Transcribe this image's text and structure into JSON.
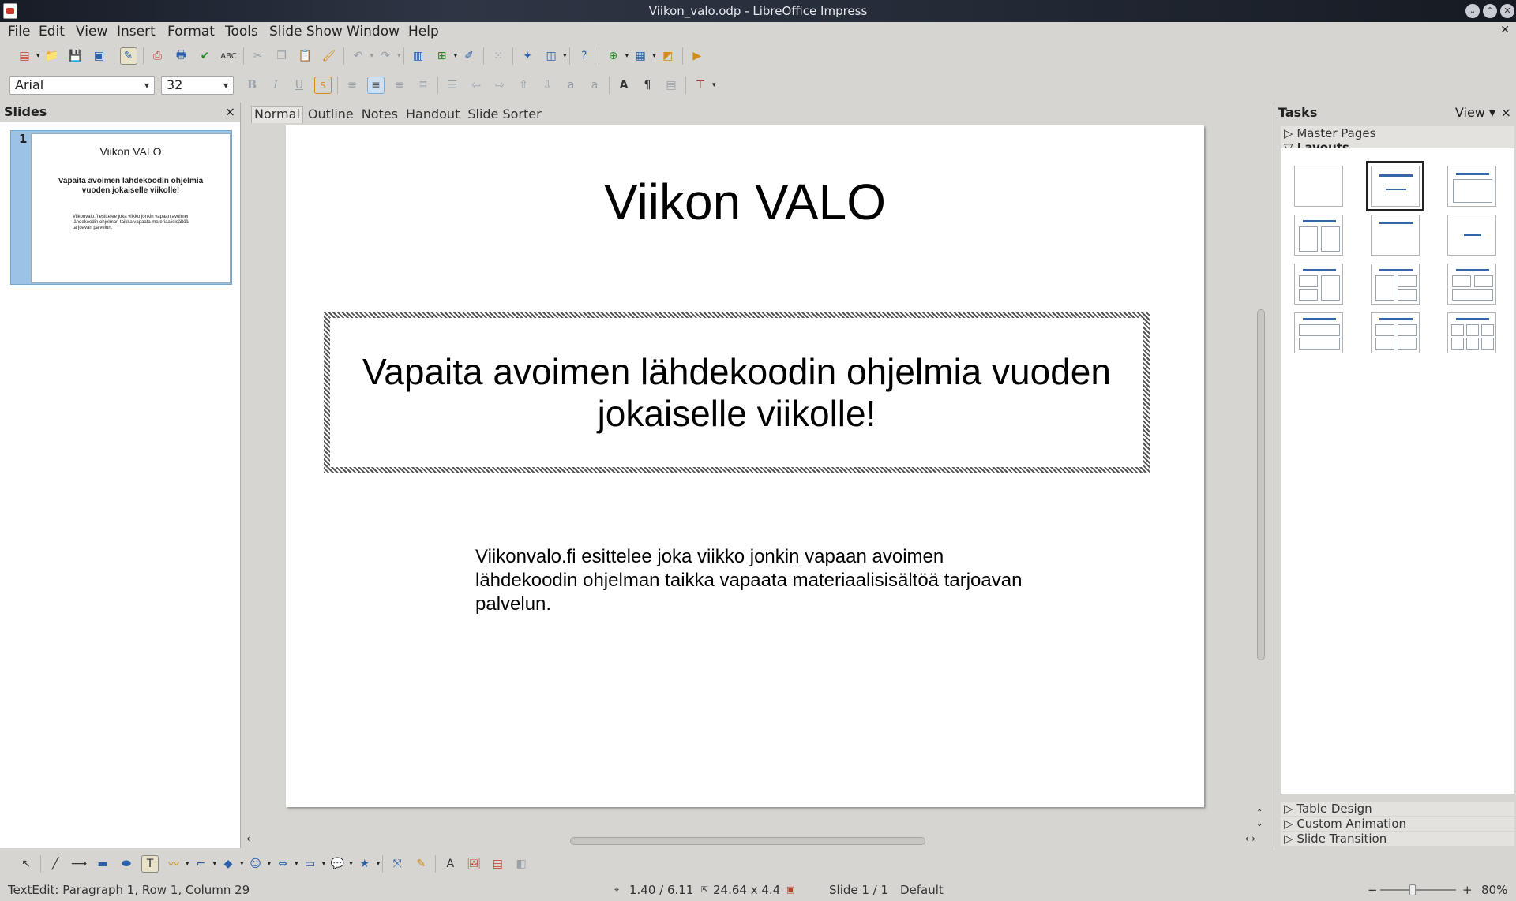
{
  "window": {
    "title": "Viikon_valo.odp - LibreOffice Impress"
  },
  "menu": [
    "File",
    "Edit",
    "View",
    "Insert",
    "Format",
    "Tools",
    "Slide Show",
    "Window",
    "Help"
  ],
  "format_bar": {
    "font": "Arial",
    "size": "32"
  },
  "slides_panel": {
    "title": "Slides",
    "close": "×",
    "thumb_number": "1"
  },
  "view_tabs": [
    "Normal",
    "Outline",
    "Notes",
    "Handout",
    "Slide Sorter"
  ],
  "slide": {
    "title": "Viikon VALO",
    "subtitle": "Vapaita avoimen lähdekoodin ohjelmia vuoden jokaiselle viikolle!",
    "body": "Viikonvalo.fi esittelee joka viikko jonkin vapaan avoimen lähdekoodin ohjelman taikka vapaata materiaalisisältöä tarjoavan palvelun."
  },
  "tasks": {
    "title": "Tasks",
    "view": "View",
    "close": "×",
    "master_pages": "Master Pages",
    "layouts": "Layouts",
    "table_design": "Table Design",
    "custom_animation": "Custom Animation",
    "slide_transition": "Slide Transition"
  },
  "status": {
    "edit": "TextEdit: Paragraph 1, Row 1, Column 29",
    "position": "1.40 / 6.11",
    "size": "24.64 x 4.4",
    "slide": "Slide 1 / 1",
    "master": "Default",
    "zoom": "80%"
  },
  "colors": {
    "accent": "#3466a8",
    "selection": "#9cc3e6"
  }
}
